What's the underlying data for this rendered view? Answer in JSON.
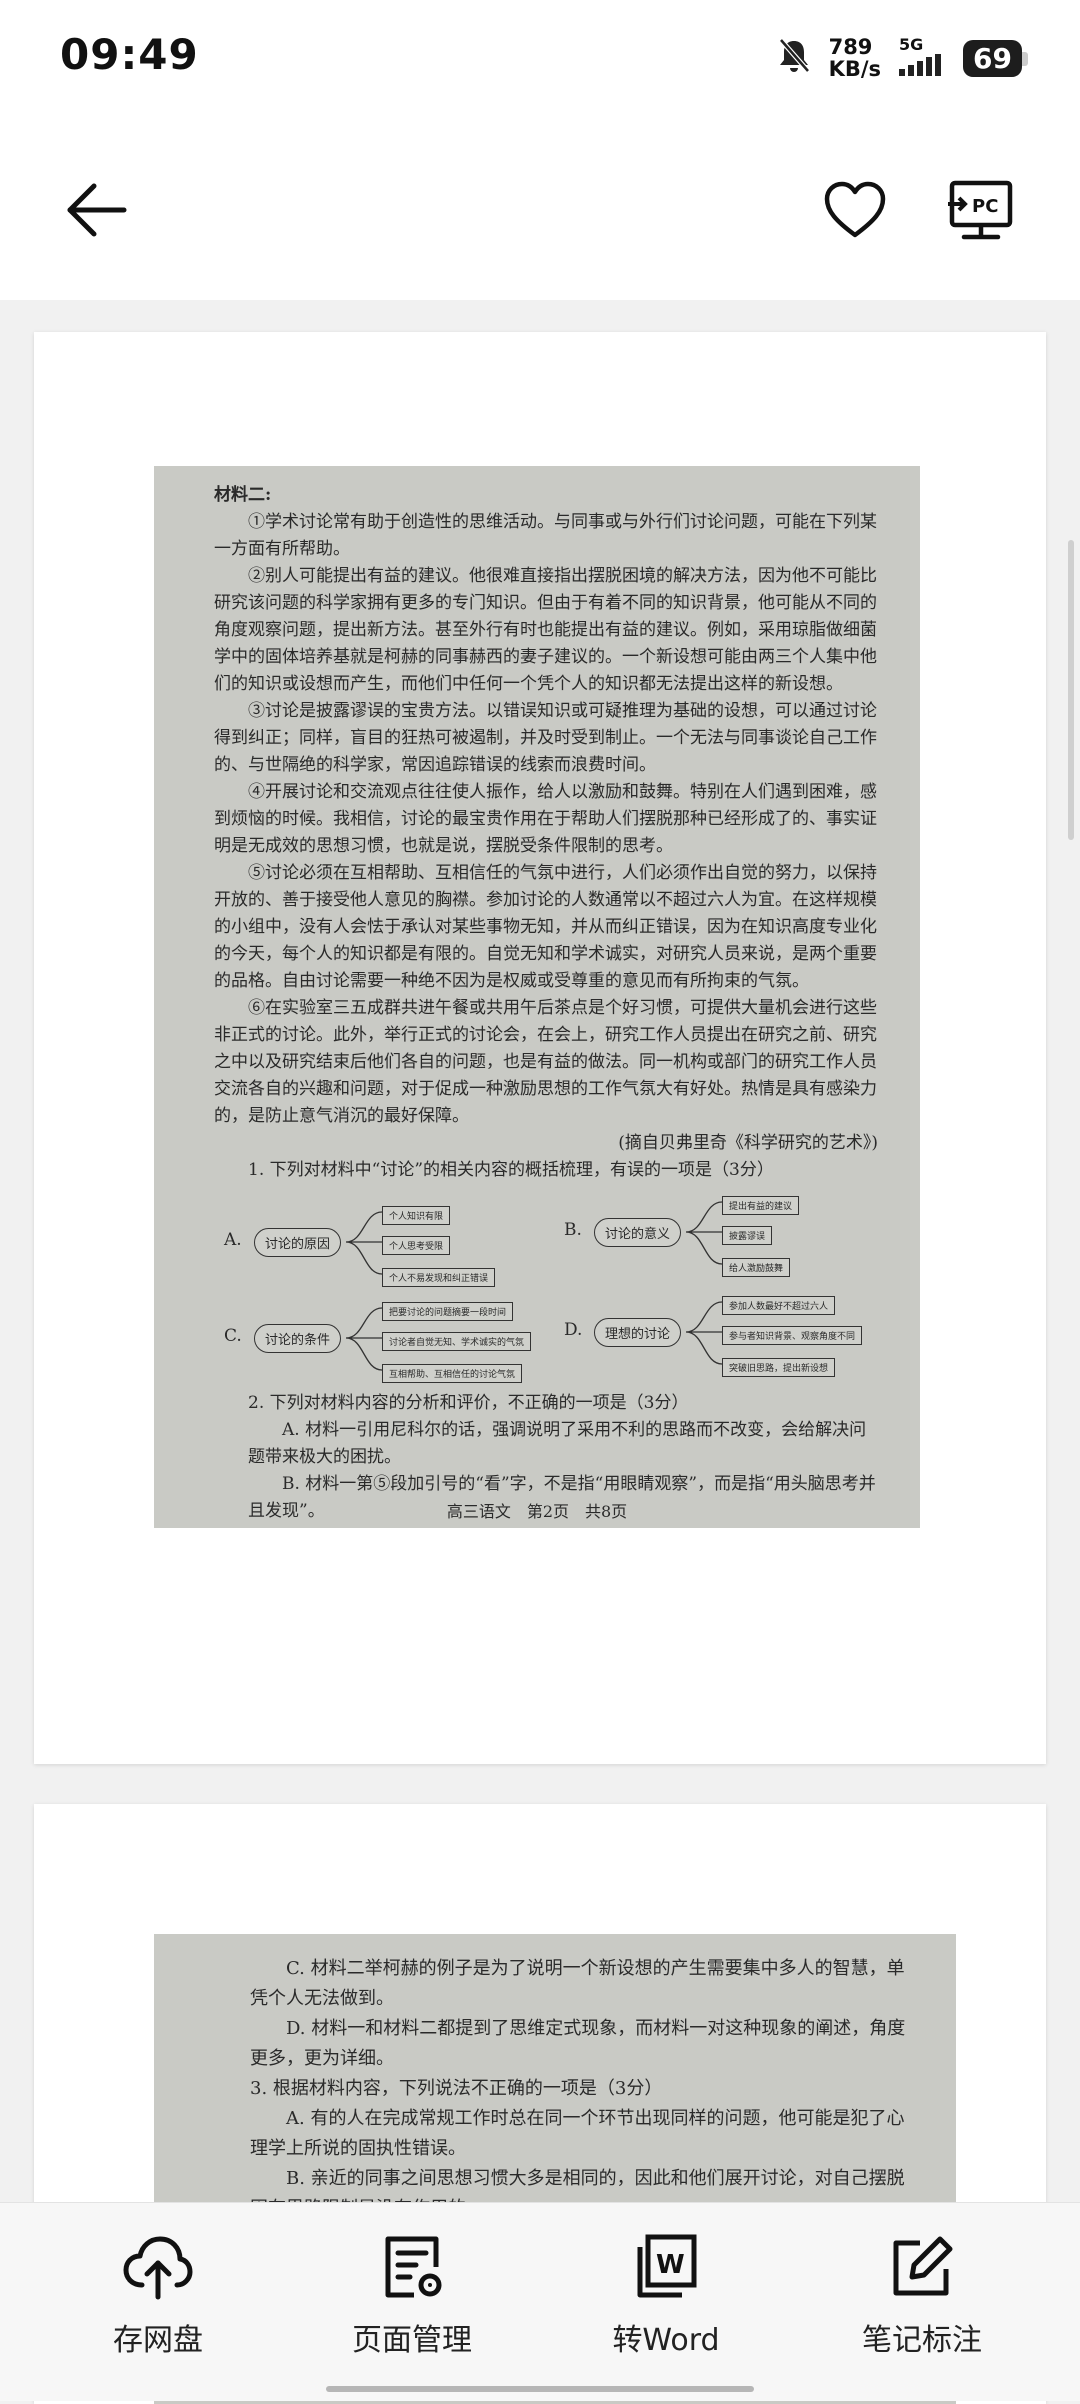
{
  "status_bar": {
    "time": "09:49",
    "speed_value": "789",
    "speed_unit": "KB/s",
    "network": "5G",
    "battery": "69"
  },
  "toolbar": {
    "items": [
      {
        "label": "存网盘",
        "icon": "cloud-upload-icon"
      },
      {
        "label": "页面管理",
        "icon": "page-manage-icon"
      },
      {
        "label": "转Word",
        "icon": "word-convert-icon"
      },
      {
        "label": "笔记标注",
        "icon": "edit-note-icon"
      }
    ]
  },
  "page1": {
    "heading": "材料二:",
    "paragraphs": [
      "①学术讨论常有助于创造性的思维活动。与同事或与外行们讨论问题，可能在下列某一方面有所帮助。",
      "②别人可能提出有益的建议。他很难直接指出摆脱困境的解决方法，因为他不可能比研究该问题的科学家拥有更多的专门知识。但由于有着不同的知识背景，他可能从不同的角度观察问题，提出新方法。甚至外行有时也能提出有益的建议。例如，采用琼脂做细菌学中的固体培养基就是柯赫的同事赫西的妻子建议的。一个新设想可能由两三个人集中他们的知识或设想而产生，而他们中任何一个凭个人的知识都无法提出这样的新设想。",
      "③讨论是披露谬误的宝贵方法。以错误知识或可疑推理为基础的设想，可以通过讨论得到纠正；同样，盲目的狂热可被遏制，并及时受到制止。一个无法与同事谈论自己工作的、与世隔绝的科学家，常因追踪错误的线索而浪费时间。",
      "④开展讨论和交流观点往往使人振作，给人以激励和鼓舞。特别在人们遇到困难，感到烦恼的时候。我相信，讨论的最宝贵作用在于帮助人们摆脱那种已经形成了的、事实证明是无成效的思想习惯，也就是说，摆脱受条件限制的思考。",
      "⑤讨论必须在互相帮助、互相信任的气氛中进行，人们必须作出自觉的努力，以保持开放的、善于接受他人意见的胸襟。参加讨论的人数通常以不超过六人为宜。在这样规模的小组中，没有人会怯于承认对某些事物无知，并从而纠正错误，因为在知识高度专业化的今天，每个人的知识都是有限的。自觉无知和学术诚实，对研究人员来说，是两个重要的品格。自由讨论需要一种绝不因为是权威或受尊重的意见而有所拘束的气氛。",
      "⑥在实验室三五成群共进午餐或共用午后茶点是个好习惯，可提供大量机会进行这些非正式的讨论。此外，举行正式的讨论会，在会上，研究工作人员提出在研究之前、研究之中以及研究结束后他们各自的问题，也是有益的做法。同一机构或部门的研究工作人员交流各自的兴趣和问题，对于促成一种激励思想的工作气氛大有好处。热情是具有感染力的，是防止意气消沉的最好保障。"
    ],
    "source": "(摘自贝弗里奇《科学研究的艺术》)",
    "q1": "1. 下列对材料中“讨论”的相关内容的概括梳理，有误的一项是（3分）",
    "diagrams": [
      {
        "letter": "A.",
        "center": "讨论的原因",
        "leaves": [
          "个人知识有限",
          "个人思考受限",
          "个人不易发现和纠正错误"
        ]
      },
      {
        "letter": "B.",
        "center": "讨论的意义",
        "leaves": [
          "提出有益的建议",
          "披露谬误",
          "给人激励鼓舞"
        ]
      },
      {
        "letter": "C.",
        "center": "讨论的条件",
        "leaves": [
          "把要讨论的问题摘要一段时间",
          "讨论者自觉无知、学术诚实的气氛",
          "互相帮助、互相信任的讨论气氛"
        ]
      },
      {
        "letter": "D.",
        "center": "理想的讨论",
        "leaves": [
          "参加人数最好不超过六人",
          "参与者知识背景、观察角度不同",
          "突破旧思路，提出新设想"
        ]
      }
    ],
    "q2": "2. 下列对材料内容的分析和评价，不正确的一项是（3分）",
    "q2_options": [
      "A. 材料一引用尼科尔的话，强调说明了采用不利的思路而不改变，会给解决问题带来极大的困扰。",
      "B. 材料一第⑤段加引号的“看”字，不是指“用眼睛观察”，而是指“用头脑思考并且发现”。"
    ],
    "footer": "高三语文　第2页　共8页"
  },
  "page2": {
    "lines": [
      "C. 材料二举柯赫的例子是为了说明一个新设想的产生需要集中多人的智慧，单凭个人无法做到。",
      "D. 材料一和材料二都提到了思维定式现象，而材料一对这种现象的阐述，角度更多，更为详细。",
      "3. 根据材料内容，下列说法不正确的一项是（3分）",
      "A. 有的人在完成常规工作时总在同一个环节出现同样的问题，他可能是犯了心理学上所说的固执性错误。",
      "B. 亲近的同事之间思想习惯大多是相同的，因此和他们展开讨论，对自己摆脱固有思路限制是没有作用的。"
    ]
  }
}
